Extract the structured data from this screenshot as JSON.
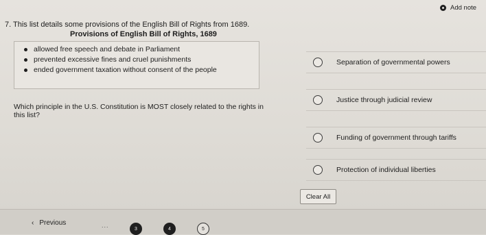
{
  "header": {
    "add_note_label": "Add note"
  },
  "question": {
    "line1": "7. This list details some provisions of the English Bill of Rights from 1689.",
    "table_title": "Provisions of English Bill of Rights, 1689",
    "provisions": [
      "allowed free speech and debate in Parliament",
      "prevented excessive fines and cruel punishments",
      "ended government taxation without consent of the people"
    ],
    "prompt_line1": "Which principle in the U.S. Constitution is MOST closely related to the rights in",
    "prompt_line2": "this list?"
  },
  "choices": [
    "Separation of governmental powers",
    "Justice through judicial review",
    "Funding of government through tariffs",
    "Protection of individual liberties"
  ],
  "clear_all_label": "Clear All",
  "footer": {
    "previous_label": "Previous",
    "ellipsis": "...",
    "pages": [
      {
        "label": "3",
        "status": "answered"
      },
      {
        "label": "4",
        "status": "answered"
      },
      {
        "label": "5",
        "status": "unanswered"
      }
    ]
  }
}
